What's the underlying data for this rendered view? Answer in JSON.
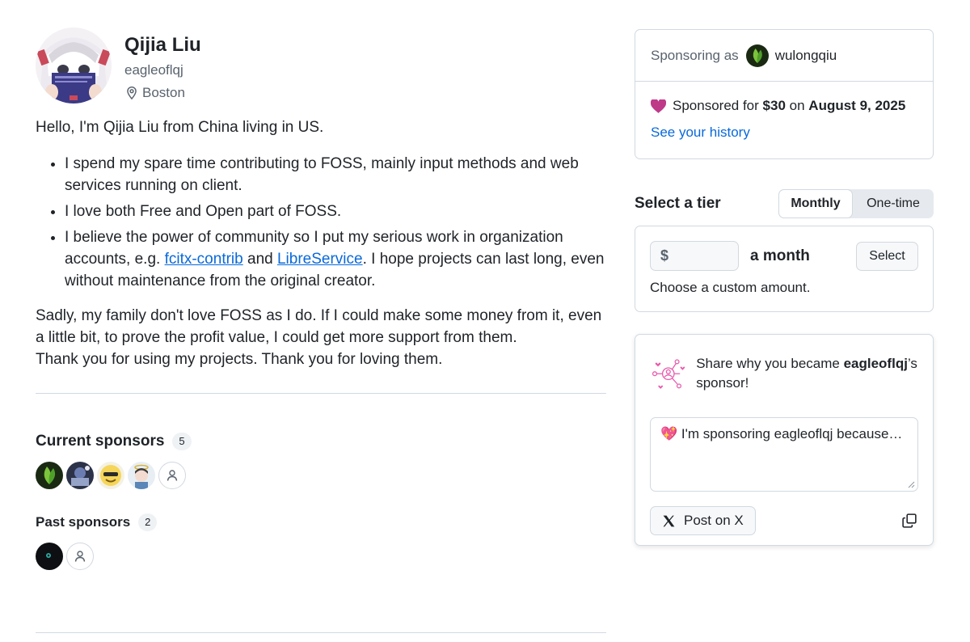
{
  "profile": {
    "name": "Qijia Liu",
    "login": "eagleoflqj",
    "location": "Boston"
  },
  "bio": {
    "intro": "Hello, I'm Qijia Liu from China living in US.",
    "bullets": [
      "I spend my spare time contributing to FOSS, mainly input methods and web services running on client.",
      "I love both Free and Open part of FOSS."
    ],
    "bullet3": {
      "before": "I believe the power of community so I put my serious work in organization accounts, e.g. ",
      "link1": "fcitx-contrib",
      "middle": " and ",
      "link2": "LibreService",
      "after": ". I hope projects can last long, even without maintenance from the original creator."
    },
    "outro1": "Sadly, my family don't love FOSS as I do. If I could make some money from it, even a little bit, to prove the profit value, I could get more support from them.",
    "outro2": "Thank you for using my projects. Thank you for loving them."
  },
  "current_sponsors": {
    "title": "Current sponsors",
    "count": "5"
  },
  "past_sponsors": {
    "title": "Past sponsors",
    "count": "2"
  },
  "sponsoring": {
    "label": "Sponsoring as",
    "user": "wulongqiu",
    "sponsored_prefix": "Sponsored for ",
    "amount": "$30",
    "on": " on ",
    "date": "August 9, 2025",
    "history_link": "See your history"
  },
  "tier": {
    "title": "Select a tier",
    "monthly": "Monthly",
    "one_time": "One-time",
    "currency": "$",
    "per": "a month",
    "select": "Select",
    "custom": "Choose a custom amount."
  },
  "share": {
    "prefix": "Share why you became ",
    "user": "eagleoflqj",
    "suffix": "’s sponsor!",
    "message": "💖 I'm sponsoring eagleoflqj because…",
    "post": "Post on X"
  },
  "colors": {
    "accent": "#0969da",
    "heart": "#bf3989",
    "pink": "#e85aad"
  }
}
